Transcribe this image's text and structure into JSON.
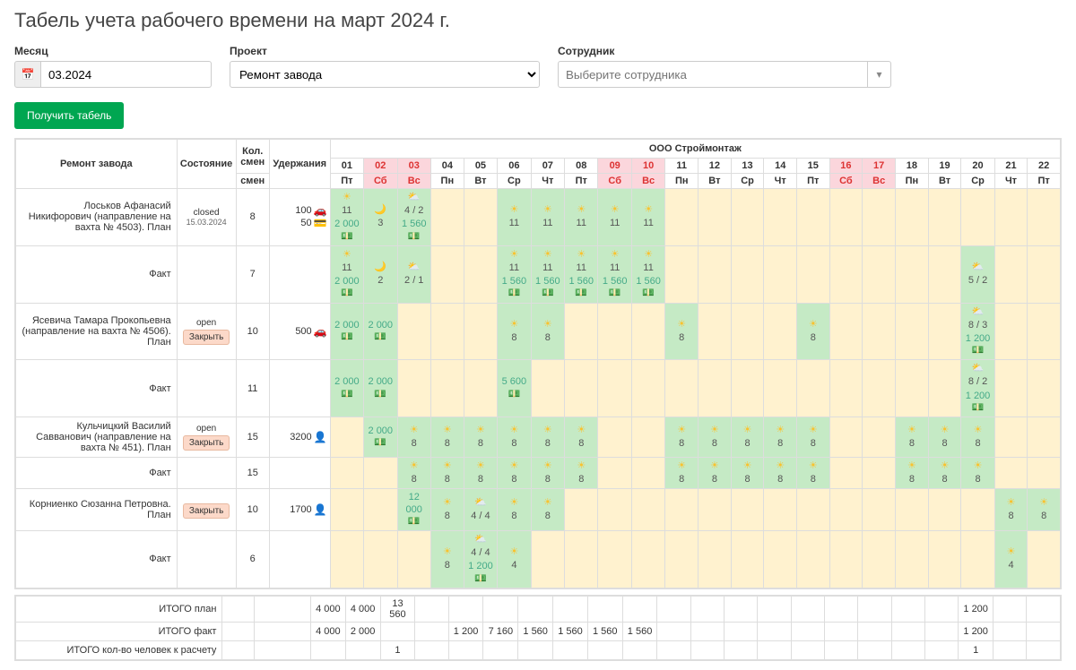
{
  "page_title": "Табель учета рабочего времени на март 2024 г.",
  "filters": {
    "month_label": "Месяц",
    "month_value": "03.2024",
    "project_label": "Проект",
    "project_value": "Ремонт завода",
    "employee_label": "Сотрудник",
    "employee_placeholder": "Выберите сотрудника"
  },
  "get_button": "Получить табель",
  "company": "ООО Строймонтаж",
  "project_header": "Ремонт завода",
  "col_status": "Состояние",
  "col_shifts": "Кол. смен",
  "col_ded": "Удержания",
  "days": [
    {
      "d": "01",
      "w": "Пт",
      "wk": false
    },
    {
      "d": "02",
      "w": "Сб",
      "wk": true
    },
    {
      "d": "03",
      "w": "Вс",
      "wk": true
    },
    {
      "d": "04",
      "w": "Пн",
      "wk": false
    },
    {
      "d": "05",
      "w": "Вт",
      "wk": false
    },
    {
      "d": "06",
      "w": "Ср",
      "wk": false
    },
    {
      "d": "07",
      "w": "Чт",
      "wk": false
    },
    {
      "d": "08",
      "w": "Пт",
      "wk": false
    },
    {
      "d": "09",
      "w": "Сб",
      "wk": true
    },
    {
      "d": "10",
      "w": "Вс",
      "wk": true
    },
    {
      "d": "11",
      "w": "Пн",
      "wk": false
    },
    {
      "d": "12",
      "w": "Вт",
      "wk": false
    },
    {
      "d": "13",
      "w": "Ср",
      "wk": false
    },
    {
      "d": "14",
      "w": "Чт",
      "wk": false
    },
    {
      "d": "15",
      "w": "Пт",
      "wk": false
    },
    {
      "d": "16",
      "w": "Сб",
      "wk": true
    },
    {
      "d": "17",
      "w": "Вс",
      "wk": true
    },
    {
      "d": "18",
      "w": "Пн",
      "wk": false
    },
    {
      "d": "19",
      "w": "Вт",
      "wk": false
    },
    {
      "d": "20",
      "w": "Ср",
      "wk": false
    },
    {
      "d": "21",
      "w": "Чт",
      "wk": false
    },
    {
      "d": "22",
      "w": "Пт",
      "wk": false
    }
  ],
  "rows": [
    {
      "name": "Лоськов Афанасий Никифорович (направление на вахта № 4503). План",
      "status": {
        "type": "closed",
        "date": "15.03.2024"
      },
      "shifts": "8",
      "ded": [
        {
          "v": "100",
          "icon": "🚗"
        },
        {
          "v": "50",
          "icon": "💳"
        }
      ],
      "cells": {
        "0": {
          "t": "work",
          "ic": "☀",
          "h": "11",
          "a": "2 000"
        },
        "1": {
          "t": "work",
          "ic": "🌙",
          "h": "3"
        },
        "2": {
          "t": "work",
          "ic": "⛅",
          "h": "4 / 2",
          "a": "1 560"
        },
        "3": {
          "t": "wk"
        },
        "4": {
          "t": "wk"
        },
        "5": {
          "t": "work",
          "ic": "☀",
          "h": "11"
        },
        "6": {
          "t": "work",
          "ic": "☀",
          "h": "11"
        },
        "7": {
          "t": "work",
          "ic": "☀",
          "h": "11"
        },
        "8": {
          "t": "work",
          "ic": "☀",
          "h": "11"
        },
        "9": {
          "t": "work",
          "ic": "☀",
          "h": "11"
        },
        "10": {
          "t": "wk"
        },
        "11": {
          "t": "wk"
        },
        "12": {
          "t": "wk"
        },
        "13": {
          "t": "wk"
        },
        "14": {
          "t": "wk"
        },
        "15": {
          "t": "wk"
        },
        "16": {
          "t": "wk"
        },
        "17": {
          "t": "wk"
        },
        "18": {
          "t": "wk"
        },
        "19": {
          "t": "wk"
        },
        "20": {
          "t": "wk"
        },
        "21": {
          "t": "wk"
        }
      }
    },
    {
      "name": "Факт",
      "shifts": "7",
      "cells": {
        "0": {
          "t": "work",
          "ic": "☀",
          "h": "11",
          "a": "2 000"
        },
        "1": {
          "t": "work",
          "ic": "🌙",
          "h": "2"
        },
        "2": {
          "t": "work",
          "ic": "⛅",
          "h": "2 / 1"
        },
        "3": {
          "t": "wk"
        },
        "4": {
          "t": "wk"
        },
        "5": {
          "t": "work",
          "ic": "☀",
          "h": "11",
          "a": "1 560"
        },
        "6": {
          "t": "work",
          "ic": "☀",
          "h": "11",
          "a": "1 560"
        },
        "7": {
          "t": "work",
          "ic": "☀",
          "h": "11",
          "a": "1 560"
        },
        "8": {
          "t": "work",
          "ic": "☀",
          "h": "11",
          "a": "1 560"
        },
        "9": {
          "t": "work",
          "ic": "☀",
          "h": "11",
          "a": "1 560"
        },
        "10": {
          "t": "wk"
        },
        "11": {
          "t": "wk"
        },
        "12": {
          "t": "wk"
        },
        "13": {
          "t": "wk"
        },
        "14": {
          "t": "wk"
        },
        "15": {
          "t": "wk"
        },
        "16": {
          "t": "wk"
        },
        "17": {
          "t": "wk"
        },
        "18": {
          "t": "wk"
        },
        "19": {
          "t": "work",
          "ic": "⛅",
          "h": "5 / 2"
        },
        "20": {
          "t": "wk"
        },
        "21": {
          "t": "wk"
        }
      }
    },
    {
      "name": "Ясевича Тамара Прокопьевна (направление на вахта № 4506). План",
      "status": {
        "type": "open"
      },
      "shifts": "10",
      "ded": [
        {
          "v": "500",
          "icon": "🚗"
        }
      ],
      "cells": {
        "0": {
          "t": "work",
          "a": "2 000"
        },
        "1": {
          "t": "work",
          "a": "2 000"
        },
        "2": {
          "t": "wk"
        },
        "3": {
          "t": "wk"
        },
        "4": {
          "t": "wk"
        },
        "5": {
          "t": "work",
          "ic": "☀",
          "h": "8"
        },
        "6": {
          "t": "work",
          "ic": "☀",
          "h": "8"
        },
        "7": {
          "t": "wk"
        },
        "8": {
          "t": "wk"
        },
        "9": {
          "t": "wk"
        },
        "10": {
          "t": "work",
          "ic": "☀",
          "h": "8"
        },
        "11": {
          "t": "wk"
        },
        "12": {
          "t": "wk"
        },
        "13": {
          "t": "wk"
        },
        "14": {
          "t": "work",
          "ic": "☀",
          "h": "8"
        },
        "15": {
          "t": "wk"
        },
        "16": {
          "t": "wk"
        },
        "17": {
          "t": "wk"
        },
        "18": {
          "t": "wk"
        },
        "19": {
          "t": "work",
          "ic": "⛅",
          "h": "8 / 3",
          "a": "1 200"
        },
        "20": {
          "t": "wk"
        },
        "21": {
          "t": "wk"
        }
      }
    },
    {
      "name": "Факт",
      "shifts": "11",
      "cells": {
        "0": {
          "t": "work",
          "a": "2 000"
        },
        "1": {
          "t": "work",
          "a": "2 000"
        },
        "2": {
          "t": "wk"
        },
        "3": {
          "t": "wk"
        },
        "4": {
          "t": "wk"
        },
        "5": {
          "t": "work",
          "a": "5 600"
        },
        "6": {
          "t": "wk"
        },
        "7": {
          "t": "wk"
        },
        "8": {
          "t": "wk"
        },
        "9": {
          "t": "wk"
        },
        "10": {
          "t": "wk"
        },
        "11": {
          "t": "wk"
        },
        "12": {
          "t": "wk"
        },
        "13": {
          "t": "wk"
        },
        "14": {
          "t": "wk"
        },
        "15": {
          "t": "wk"
        },
        "16": {
          "t": "wk"
        },
        "17": {
          "t": "wk"
        },
        "18": {
          "t": "wk"
        },
        "19": {
          "t": "work",
          "ic": "⛅",
          "h": "8 / 2",
          "a": "1 200"
        },
        "20": {
          "t": "wk"
        },
        "21": {
          "t": "wk"
        }
      }
    },
    {
      "name": "Кульчицкий Василий Савванович (направление на вахта № 451). План",
      "status": {
        "type": "open"
      },
      "shifts": "15",
      "ded": [
        {
          "v": "3200",
          "icon": "👤"
        }
      ],
      "cells": {
        "0": {
          "t": "wk"
        },
        "1": {
          "t": "work",
          "a": "2 000"
        },
        "2": {
          "t": "work",
          "ic": "☀",
          "h": "8"
        },
        "3": {
          "t": "work",
          "ic": "☀",
          "h": "8"
        },
        "4": {
          "t": "work",
          "ic": "☀",
          "h": "8"
        },
        "5": {
          "t": "work",
          "ic": "☀",
          "h": "8"
        },
        "6": {
          "t": "work",
          "ic": "☀",
          "h": "8"
        },
        "7": {
          "t": "work",
          "ic": "☀",
          "h": "8"
        },
        "8": {
          "t": "wk"
        },
        "9": {
          "t": "wk"
        },
        "10": {
          "t": "work",
          "ic": "☀",
          "h": "8"
        },
        "11": {
          "t": "work",
          "ic": "☀",
          "h": "8"
        },
        "12": {
          "t": "work",
          "ic": "☀",
          "h": "8"
        },
        "13": {
          "t": "work",
          "ic": "☀",
          "h": "8"
        },
        "14": {
          "t": "work",
          "ic": "☀",
          "h": "8"
        },
        "15": {
          "t": "wk"
        },
        "16": {
          "t": "wk"
        },
        "17": {
          "t": "work",
          "ic": "☀",
          "h": "8"
        },
        "18": {
          "t": "work",
          "ic": "☀",
          "h": "8"
        },
        "19": {
          "t": "work",
          "ic": "☀",
          "h": "8"
        },
        "20": {
          "t": "wk"
        },
        "21": {
          "t": "wk"
        }
      }
    },
    {
      "name": "Факт",
      "shifts": "15",
      "cells": {
        "0": {
          "t": "wk"
        },
        "1": {
          "t": "wk"
        },
        "2": {
          "t": "work",
          "ic": "☀",
          "h": "8"
        },
        "3": {
          "t": "work",
          "ic": "☀",
          "h": "8"
        },
        "4": {
          "t": "work",
          "ic": "☀",
          "h": "8"
        },
        "5": {
          "t": "work",
          "ic": "☀",
          "h": "8"
        },
        "6": {
          "t": "work",
          "ic": "☀",
          "h": "8"
        },
        "7": {
          "t": "work",
          "ic": "☀",
          "h": "8"
        },
        "8": {
          "t": "wk"
        },
        "9": {
          "t": "wk"
        },
        "10": {
          "t": "work",
          "ic": "☀",
          "h": "8"
        },
        "11": {
          "t": "work",
          "ic": "☀",
          "h": "8"
        },
        "12": {
          "t": "work",
          "ic": "☀",
          "h": "8"
        },
        "13": {
          "t": "work",
          "ic": "☀",
          "h": "8"
        },
        "14": {
          "t": "work",
          "ic": "☀",
          "h": "8"
        },
        "15": {
          "t": "wk"
        },
        "16": {
          "t": "wk"
        },
        "17": {
          "t": "work",
          "ic": "☀",
          "h": "8"
        },
        "18": {
          "t": "work",
          "ic": "☀",
          "h": "8"
        },
        "19": {
          "t": "work",
          "ic": "☀",
          "h": "8"
        },
        "20": {
          "t": "wk"
        },
        "21": {
          "t": "wk"
        }
      }
    },
    {
      "name": "Корниенко Сюзанна Петровна. План",
      "status": {
        "type": "open_noline"
      },
      "shifts": "10",
      "ded": [
        {
          "v": "1700",
          "icon": "👤"
        }
      ],
      "cells": {
        "0": {
          "t": "wk"
        },
        "1": {
          "t": "wk"
        },
        "2": {
          "t": "work",
          "a": "12 000"
        },
        "3": {
          "t": "work",
          "ic": "☀",
          "h": "8"
        },
        "4": {
          "t": "work",
          "ic": "⛅",
          "h": "4 / 4"
        },
        "5": {
          "t": "work",
          "ic": "☀",
          "h": "8"
        },
        "6": {
          "t": "work",
          "ic": "☀",
          "h": "8"
        },
        "7": {
          "t": "wk"
        },
        "8": {
          "t": "wk"
        },
        "9": {
          "t": "wk"
        },
        "10": {
          "t": "wk"
        },
        "11": {
          "t": "wk"
        },
        "12": {
          "t": "wk"
        },
        "13": {
          "t": "wk"
        },
        "14": {
          "t": "wk"
        },
        "15": {
          "t": "wk"
        },
        "16": {
          "t": "wk"
        },
        "17": {
          "t": "wk"
        },
        "18": {
          "t": "wk"
        },
        "19": {
          "t": "wk"
        },
        "20": {
          "t": "work",
          "ic": "☀",
          "h": "8"
        },
        "21": {
          "t": "work",
          "ic": "☀",
          "h": "8"
        }
      }
    },
    {
      "name": "Факт",
      "shifts": "6",
      "cells": {
        "0": {
          "t": "wk"
        },
        "1": {
          "t": "wk"
        },
        "2": {
          "t": "wk"
        },
        "3": {
          "t": "work",
          "ic": "☀",
          "h": "8"
        },
        "4": {
          "t": "work",
          "ic": "⛅",
          "h": "4 / 4",
          "a": "1 200"
        },
        "5": {
          "t": "work",
          "ic": "☀",
          "h": "4"
        },
        "6": {
          "t": "wk"
        },
        "7": {
          "t": "wk"
        },
        "8": {
          "t": "wk"
        },
        "9": {
          "t": "wk"
        },
        "10": {
          "t": "wk"
        },
        "11": {
          "t": "wk"
        },
        "12": {
          "t": "wk"
        },
        "13": {
          "t": "wk"
        },
        "14": {
          "t": "wk"
        },
        "15": {
          "t": "wk"
        },
        "16": {
          "t": "wk"
        },
        "17": {
          "t": "wk"
        },
        "18": {
          "t": "wk"
        },
        "19": {
          "t": "wk"
        },
        "20": {
          "t": "work",
          "ic": "☀",
          "h": "4"
        },
        "21": {
          "t": "wk"
        }
      }
    }
  ],
  "totals": [
    {
      "label": "ИТОГО план",
      "cells": {
        "0": "4 000",
        "1": "4 000",
        "2": "13 560",
        "19": "1 200"
      }
    },
    {
      "label": "ИТОГО факт",
      "cells": {
        "0": "4 000",
        "1": "2 000",
        "4": "1 200",
        "5": "7 160",
        "6": "1 560",
        "7": "1 560",
        "8": "1 560",
        "9": "1 560",
        "19": "1 200"
      }
    },
    {
      "label": "ИТОГО кол-во человек к расчету",
      "cells": {
        "2": "1",
        "19": "1"
      }
    }
  ],
  "status_labels": {
    "closed": "closed",
    "open": "open",
    "close_btn": "Закрыть"
  }
}
